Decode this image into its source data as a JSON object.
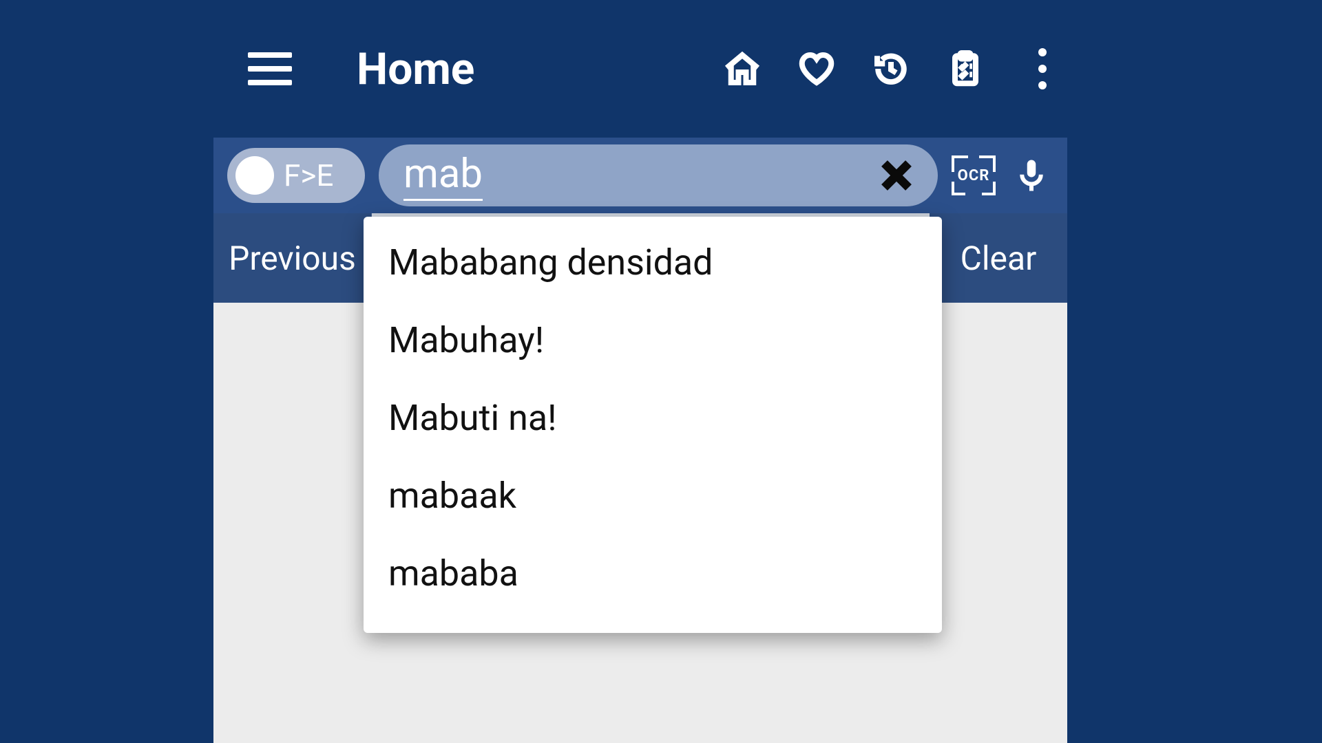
{
  "header": {
    "title": "Home",
    "icons": {
      "home": "home-icon",
      "favorite": "heart-icon",
      "history": "history-icon",
      "clipboard": "clipboard-icon",
      "overflow": "more-vertical-icon"
    }
  },
  "search": {
    "toggle_label": "F>E",
    "value": "mab",
    "ocr_label": "OCR"
  },
  "buttons": {
    "previous": "Previous",
    "middle": "",
    "clear": "Clear"
  },
  "suggestions": [
    "Mababang densidad",
    "Mabuhay!",
    "Mabuti na!",
    "mabaak",
    "mababa"
  ]
}
